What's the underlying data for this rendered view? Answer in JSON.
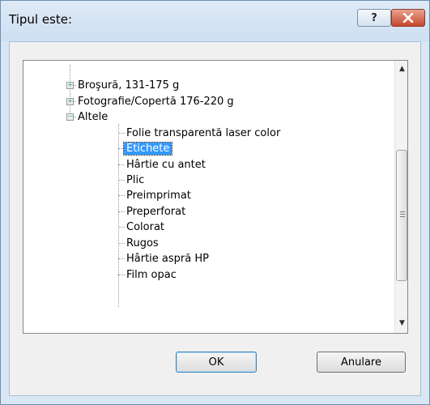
{
  "dialog": {
    "title": "Tipul este:",
    "help_label": "?",
    "close_label": "✕"
  },
  "tree": {
    "items": [
      {
        "label": "Broşură, 131-175 g",
        "level": 0,
        "expander": "+"
      },
      {
        "label": "Fotografie/Copertă 176-220 g",
        "level": 0,
        "expander": "+"
      },
      {
        "label": "Altele",
        "level": 0,
        "expander": "−"
      },
      {
        "label": "Folie transparentă laser color",
        "level": 1
      },
      {
        "label": "Etichete",
        "level": 1,
        "selected": true
      },
      {
        "label": "Hârtie cu antet",
        "level": 1
      },
      {
        "label": "Plic",
        "level": 1
      },
      {
        "label": "Preimprimat",
        "level": 1
      },
      {
        "label": "Preperforat",
        "level": 1
      },
      {
        "label": "Colorat",
        "level": 1
      },
      {
        "label": "Rugos",
        "level": 1
      },
      {
        "label": "Hârtie aspră HP",
        "level": 1
      },
      {
        "label": "Film opac",
        "level": 1
      }
    ]
  },
  "buttons": {
    "ok": "OK",
    "cancel": "Anulare"
  },
  "colors": {
    "selection": "#3399ff",
    "window_border": "#6b8fb3",
    "close_button": "#c6472c"
  }
}
